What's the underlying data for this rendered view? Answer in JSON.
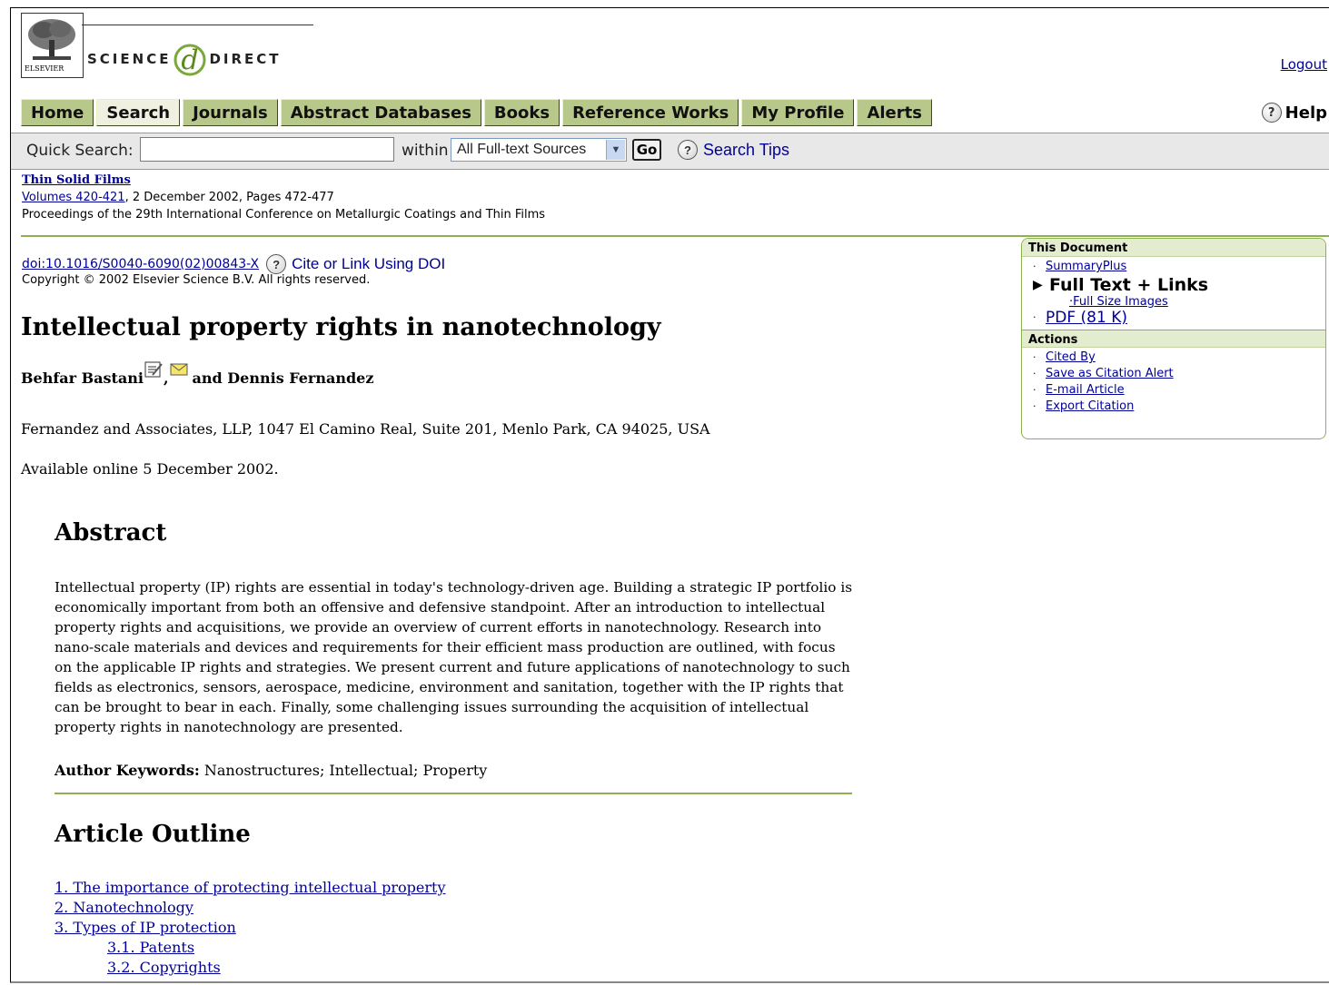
{
  "header": {
    "elsevier_label": "ELSEVIER",
    "brand_left": "SCIENCE",
    "brand_right": "DIRECT",
    "logout": "Logout"
  },
  "nav": {
    "items": [
      "Home",
      "Search",
      "Journals",
      "Abstract Databases",
      "Books",
      "Reference Works",
      "My Profile",
      "Alerts"
    ],
    "help": "Help"
  },
  "quick_search": {
    "label": "Quick Search:",
    "value": "",
    "within_label": "within",
    "selected_source": "All Full-text Sources",
    "go": "Go",
    "tips": "Search Tips"
  },
  "journal": {
    "title": "Thin Solid Films",
    "volume_link": "Volumes 420-421",
    "date_pages": ", 2 December 2002, Pages 472-477",
    "proceedings": "Proceedings of the 29th International Conference on Metallurgic Coatings and Thin Films"
  },
  "article": {
    "doi": "doi:10.1016/S0040-6090(02)00843-X",
    "cite_link": "Cite or Link Using DOI",
    "copyright": "Copyright © 2002 Elsevier Science B.V. All rights reserved.",
    "title": "Intellectual property rights in nanotechnology",
    "author1": "Behfar Bastani",
    "author_sep": ",",
    "author_conj": "and Dennis Fernandez",
    "affiliation": "Fernandez and Associates, LLP, 1047 El Camino Real, Suite 201, Menlo Park, CA 94025, USA",
    "available": "Available online 5 December 2002."
  },
  "abstract": {
    "heading": "Abstract",
    "text": "Intellectual property (IP) rights are essential in today's technology-driven age. Building a strategic IP portfolio is economically important from both an offensive and defensive standpoint. After an introduction to intellectual property rights and acquisitions, we provide an overview of current efforts in nanotechnology. Research into nano-scale materials and devices and requirements for their efficient mass production are outlined, with focus on the applicable IP rights and strategies. We present current and future applications of nanotechnology to such fields as electronics, sensors, aerospace, medicine, environment and sanitation, together with the IP rights that can be brought to bear in each. Finally, some challenging issues surrounding the acquisition of intellectual property rights in nanotechnology are presented.",
    "keywords_label": "Author Keywords:",
    "keywords": "Nanostructures; Intellectual; Property"
  },
  "outline": {
    "heading": "Article Outline",
    "items": [
      "1. The importance of protecting intellectual property",
      "2. Nanotechnology",
      "3. Types of IP protection",
      "3.1. Patents",
      "3.2. Copyrights"
    ]
  },
  "sidebar": {
    "this_document": "This Document",
    "summary_plus": "SummaryPlus",
    "full_text": "Full Text + Links",
    "full_size_images": "·Full Size Images",
    "pdf": "PDF (81 K)",
    "actions": "Actions",
    "action_items": [
      "Cited By",
      "Save as Citation Alert",
      "E-mail Article",
      "Export Citation"
    ]
  },
  "colors": {
    "nav_button": "#b8c88a",
    "accent_rule": "#8fb050",
    "link": "#000099"
  }
}
